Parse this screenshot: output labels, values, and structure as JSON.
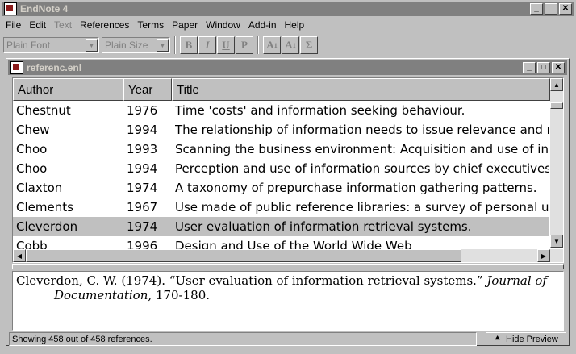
{
  "app": {
    "title": "EndNote 4"
  },
  "menu": [
    {
      "label": "File",
      "disabled": false
    },
    {
      "label": "Edit",
      "disabled": false
    },
    {
      "label": "Text",
      "disabled": true
    },
    {
      "label": "References",
      "disabled": false
    },
    {
      "label": "Terms",
      "disabled": false
    },
    {
      "label": "Paper",
      "disabled": false
    },
    {
      "label": "Window",
      "disabled": false
    },
    {
      "label": "Add-in",
      "disabled": false
    },
    {
      "label": "Help",
      "disabled": false
    }
  ],
  "toolbar": {
    "font_value": "Plain Font",
    "size_value": "Plain Size",
    "bold": "B",
    "italic": "I",
    "underline": "U",
    "plain": "P",
    "superscript": "A",
    "subscript": "A",
    "symbol": "Σ"
  },
  "doc": {
    "title": "referenc.enl",
    "columns": {
      "author": "Author",
      "year": "Year",
      "title": "Title"
    },
    "rows": [
      {
        "author": "Chestnut",
        "year": "1976",
        "title": "Time 'costs' and information seeking behaviour."
      },
      {
        "author": "Chew",
        "year": "1994",
        "title": "The relationship of information needs to issue relevance and media"
      },
      {
        "author": "Choo",
        "year": "1993",
        "title": "Scanning the business environment: Acquisition and use of information"
      },
      {
        "author": "Choo",
        "year": "1994",
        "title": "Perception and use of information sources by chief executives in"
      },
      {
        "author": "Claxton",
        "year": "1974",
        "title": "A taxonomy of prepurchase information gathering patterns."
      },
      {
        "author": "Clements",
        "year": "1967",
        "title": "Use made of public reference libraries: a survey of personal users"
      },
      {
        "author": "Cleverdon",
        "year": "1974",
        "title": "User evaluation of information retrieval systems.",
        "selected": true
      },
      {
        "author": "Cobb",
        "year": "1996",
        "title": "Design and Use of the World Wide Web"
      }
    ],
    "preview": {
      "line1_plain": "Cleverdon, C. W. (1974). “User evaluation of information retrieval systems.” ",
      "line1_italic": "Journal of",
      "line2_italic": "Documentation",
      "line2_plain": ", 170-180."
    },
    "status": "Showing 458 out of 458 references.",
    "hide_preview": "Hide Preview"
  }
}
